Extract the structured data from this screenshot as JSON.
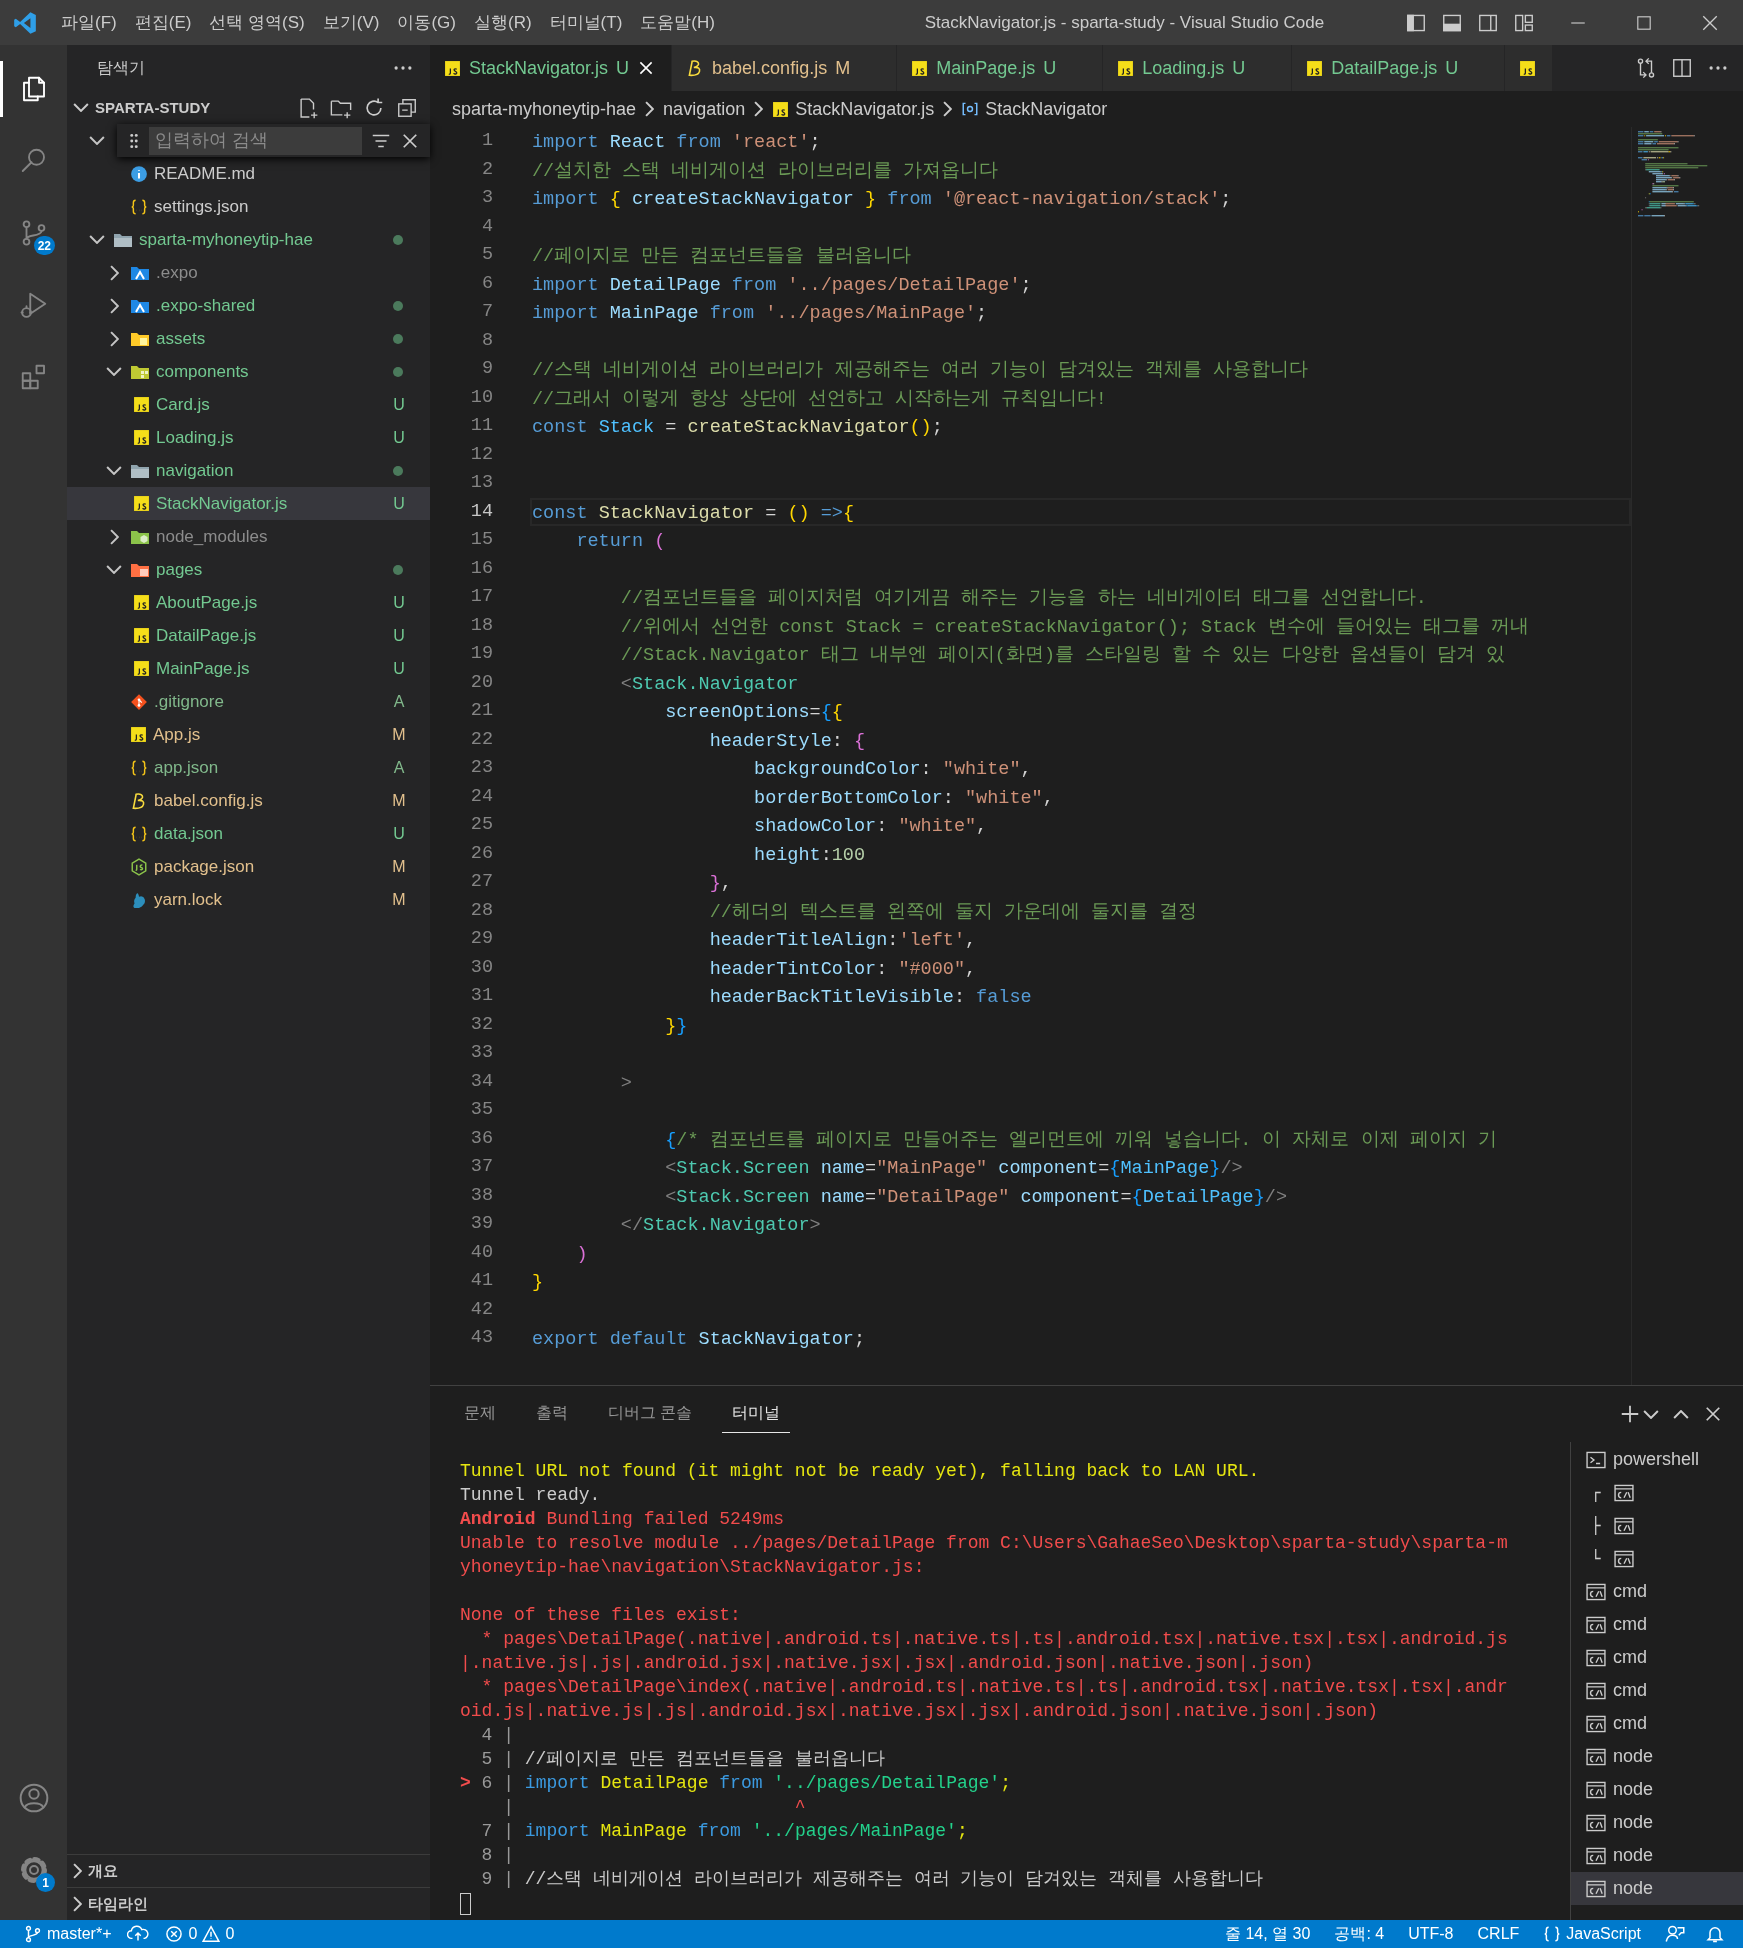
{
  "window": {
    "title": "StackNavigator.js - sparta-study - Visual Studio Code",
    "menu": [
      "파일(F)",
      "편집(E)",
      "선택 영역(S)",
      "보기(V)",
      "이동(G)",
      "실행(R)",
      "터미널(T)",
      "도움말(H)"
    ]
  },
  "activity_bar": {
    "top": [
      {
        "kind": "files",
        "selected": true
      },
      {
        "kind": "search",
        "selected": false
      },
      {
        "kind": "source-control",
        "selected": false,
        "badge": "22"
      },
      {
        "kind": "run-debug",
        "selected": false
      },
      {
        "kind": "extensions",
        "selected": false
      }
    ],
    "bottom": [
      {
        "kind": "account"
      },
      {
        "kind": "gear",
        "badge": "1"
      }
    ]
  },
  "sidebar": {
    "title": "탐색기",
    "workspace": "SPARTA-STUDY",
    "find": {
      "placeholder": "입력하여 검색"
    },
    "tree": [
      {
        "expanded": true,
        "children": [
          {
            "kind": "info",
            "name": "README.md",
            "selected": false,
            "color": "#cccccc",
            "dot": false
          },
          {
            "kind": "json",
            "name": "settings.json",
            "selected": false,
            "color": "#cccccc",
            "dot": false
          }
        ]
      },
      {
        "kind": "folder",
        "name": "sparta-myhoneytip-hae",
        "expanded": true,
        "selected": false,
        "color": "#73c991",
        "dot": true,
        "children": [
          {
            "kind": "expo",
            "name": ".expo",
            "expanded": false,
            "selected": false,
            "color": "#8c8c8c",
            "dot": false
          },
          {
            "kind": "expo",
            "name": ".expo-shared",
            "expanded": false,
            "selected": false,
            "color": "#73c991",
            "dot": true
          },
          {
            "kind": "assets",
            "name": "assets",
            "expanded": false,
            "selected": false,
            "color": "#73c991",
            "dot": true
          },
          {
            "kind": "components",
            "name": "components",
            "expanded": true,
            "selected": false,
            "color": "#73c991",
            "dot": true,
            "children": [
              {
                "kind": "js",
                "name": "Card.js",
                "selected": false,
                "color": "#73c991",
                "badge": "U",
                "dot": false
              },
              {
                "kind": "js",
                "name": "Loading.js",
                "selected": false,
                "color": "#73c991",
                "badge": "U",
                "dot": false
              }
            ]
          },
          {
            "kind": "folder",
            "name": "navigation",
            "expanded": true,
            "selected": false,
            "color": "#73c991",
            "dot": true,
            "children": [
              {
                "kind": "js",
                "name": "StackNavigator.js",
                "selected": true,
                "color": "#73c991",
                "badge": "U",
                "dot": false
              }
            ]
          },
          {
            "kind": "node",
            "name": "node_modules",
            "expanded": false,
            "selected": false,
            "color": "#8c8c8c",
            "dot": false
          },
          {
            "kind": "pages",
            "name": "pages",
            "expanded": true,
            "selected": false,
            "color": "#73c991",
            "dot": true,
            "children": [
              {
                "kind": "js",
                "name": "AboutPage.js",
                "selected": false,
                "color": "#73c991",
                "badge": "U",
                "dot": false
              },
              {
                "kind": "js",
                "name": "DatailPage.js",
                "selected": false,
                "color": "#73c991",
                "badge": "U",
                "dot": false
              },
              {
                "kind": "js",
                "name": "MainPage.js",
                "selected": false,
                "color": "#73c991",
                "badge": "U",
                "dot": false
              }
            ]
          },
          {
            "kind": "git",
            "name": ".gitignore",
            "selected": false,
            "color": "#81b88b",
            "badge": "A",
            "dot": false
          },
          {
            "kind": "js",
            "name": "App.js",
            "selected": false,
            "color": "#e2c08d",
            "badge": "M",
            "dot": false
          },
          {
            "kind": "json",
            "name": "app.json",
            "selected": false,
            "color": "#81b88b",
            "badge": "A",
            "dot": false
          },
          {
            "kind": "babel",
            "name": "babel.config.js",
            "selected": false,
            "color": "#e2c08d",
            "badge": "M",
            "dot": false
          },
          {
            "kind": "json",
            "name": "data.json",
            "selected": false,
            "color": "#73c991",
            "badge": "U",
            "dot": false
          },
          {
            "kind": "nodejs",
            "name": "package.json",
            "selected": false,
            "color": "#e2c08d",
            "badge": "M",
            "dot": false
          },
          {
            "kind": "yarn",
            "name": "yarn.lock",
            "selected": false,
            "color": "#e2c08d",
            "badge": "M",
            "dot": false
          }
        ]
      }
    ],
    "sections": [
      {
        "label": "개요",
        "expanded": false
      },
      {
        "label": "타임라인",
        "expanded": false
      }
    ]
  },
  "editor": {
    "tabs": [
      {
        "label": "StackNavigator.js",
        "kind": "js",
        "color": "#73c991",
        "badge": "U",
        "selected": true
      },
      {
        "label": "babel.config.js",
        "kind": "babel",
        "color": "#e2c08d",
        "badge": "M",
        "selected": false
      },
      {
        "label": "MainPage.js",
        "kind": "js",
        "color": "#73c991",
        "badge": "U",
        "selected": false
      },
      {
        "label": "Loading.js",
        "kind": "js",
        "color": "#73c991",
        "badge": "U",
        "selected": false
      },
      {
        "label": "DatailPage.js",
        "kind": "js",
        "color": "#73c991",
        "badge": "U",
        "selected": false
      },
      {
        "kind": "js",
        "selected": false
      }
    ],
    "breadcrumb": [
      {
        "label": "sparta-myhoneytip-hae",
        "kind": "folder"
      },
      {
        "label": "navigation",
        "kind": "folder"
      },
      {
        "label": "StackNavigator.js",
        "kind": "file"
      },
      {
        "label": "StackNavigator",
        "kind": "symbol"
      }
    ],
    "lines": [
      {
        "number": "1",
        "current": false,
        "tokens": [
          {
            "text": "import ",
            "kind": "keyword"
          },
          {
            "text": "React ",
            "kind": "variable"
          },
          {
            "text": "from ",
            "kind": "keyword"
          },
          {
            "text": "'react'",
            "kind": "string"
          },
          {
            "text": ";",
            "kind": "punct"
          }
        ]
      },
      {
        "number": "2",
        "current": false,
        "tokens": [
          {
            "text": "//설치한 스택 네비게이션 라이브러리를 가져옵니다",
            "kind": "comment"
          }
        ]
      },
      {
        "number": "3",
        "current": false,
        "tokens": [
          {
            "text": "import ",
            "kind": "keyword"
          },
          {
            "text": "{ ",
            "kind": "bracket"
          },
          {
            "text": "createStackNavigator ",
            "kind": "variable"
          },
          {
            "text": "} ",
            "kind": "bracket"
          },
          {
            "text": "from ",
            "kind": "keyword"
          },
          {
            "text": "'@react-navigation/stack'",
            "kind": "string"
          },
          {
            "text": ";",
            "kind": "punct"
          }
        ]
      },
      {
        "number": "4",
        "current": false
      },
      {
        "number": "5",
        "current": false,
        "tokens": [
          {
            "text": "//페이지로 만든 컴포넌트들을 불러옵니다",
            "kind": "comment"
          }
        ]
      },
      {
        "number": "6",
        "current": false,
        "tokens": [
          {
            "text": "import ",
            "kind": "keyword"
          },
          {
            "text": "DetailPage ",
            "kind": "variable"
          },
          {
            "text": "from ",
            "kind": "keyword"
          },
          {
            "text": "'../pages/DetailPage'",
            "kind": "string"
          },
          {
            "text": ";",
            "kind": "punct"
          }
        ]
      },
      {
        "number": "7",
        "current": false,
        "tokens": [
          {
            "text": "import ",
            "kind": "keyword"
          },
          {
            "text": "MainPage ",
            "kind": "variable"
          },
          {
            "text": "from ",
            "kind": "keyword"
          },
          {
            "text": "'../pages/MainPage'",
            "kind": "string"
          },
          {
            "text": ";",
            "kind": "punct"
          }
        ]
      },
      {
        "number": "8",
        "current": false
      },
      {
        "number": "9",
        "current": false,
        "tokens": [
          {
            "text": "//스택 네비게이션 라이브러리가 제공해주는 여러 기능이 담겨있는 객체를 사용합니다",
            "kind": "comment"
          }
        ]
      },
      {
        "number": "10",
        "current": false,
        "tokens": [
          {
            "text": "//그래서 이렇게 항상 상단에 선언하고 시작하는게 규칙입니다!",
            "kind": "comment"
          }
        ]
      },
      {
        "number": "11",
        "current": false,
        "tokens": [
          {
            "text": "const ",
            "kind": "keyword"
          },
          {
            "text": "Stack",
            "kind": "constant"
          },
          {
            "text": " = ",
            "kind": "punct"
          },
          {
            "text": "createStackNavigator",
            "kind": "function"
          },
          {
            "text": "()",
            "kind": "bracket"
          },
          {
            "text": ";",
            "kind": "punct"
          }
        ]
      },
      {
        "number": "12",
        "current": false
      },
      {
        "number": "13",
        "current": false
      },
      {
        "number": "14",
        "current": true,
        "tokens": [
          {
            "text": "const ",
            "kind": "keyword"
          },
          {
            "text": "StackNavigator",
            "kind": "function"
          },
          {
            "text": " = ",
            "kind": "punct"
          },
          {
            "text": "()",
            "kind": "bracket"
          },
          {
            "text": " =>",
            "kind": "keyword"
          },
          {
            "text": "{",
            "kind": "bracket"
          }
        ]
      },
      {
        "number": "15",
        "current": false,
        "tokens": [
          {
            "text": "    return ",
            "kind": "keyword"
          },
          {
            "text": "(",
            "kind": "bracket2"
          }
        ]
      },
      {
        "number": "16",
        "current": false
      },
      {
        "number": "17",
        "current": false,
        "tokens": [
          {
            "text": "        //컴포넌트들을 페이지처럼 여기게끔 해주는 기능을 하는 네비게이터 태그를 선언합니다.",
            "kind": "comment"
          }
        ]
      },
      {
        "number": "18",
        "current": false,
        "tokens": [
          {
            "text": "        //위에서 선언한 const Stack = createStackNavigator(); Stack 변수에 들어있는 태그를 꺼내",
            "kind": "comment"
          }
        ]
      },
      {
        "number": "19",
        "current": false,
        "tokens": [
          {
            "text": "        //Stack.Navigator 태그 내부엔 페이지(화면)를 스타일링 할 수 있는 다양한 옵션들이 담겨 있",
            "kind": "comment"
          }
        ]
      },
      {
        "number": "20",
        "current": false,
        "tokens": [
          {
            "text": "        <",
            "kind": "tagpunct"
          },
          {
            "text": "Stack.Navigator",
            "kind": "tag"
          }
        ]
      },
      {
        "number": "21",
        "current": false,
        "tokens": [
          {
            "text": "            screenOptions",
            "kind": "attr"
          },
          {
            "text": "=",
            "kind": "punct"
          },
          {
            "text": "{",
            "kind": "bracket3"
          },
          {
            "text": "{",
            "kind": "bracket"
          }
        ]
      },
      {
        "number": "22",
        "current": false,
        "tokens": [
          {
            "text": "                headerStyle",
            "kind": "variable"
          },
          {
            "text": ": ",
            "kind": "punct"
          },
          {
            "text": "{",
            "kind": "bracket2"
          }
        ]
      },
      {
        "number": "23",
        "current": false,
        "tokens": [
          {
            "text": "                    backgroundColor",
            "kind": "variable"
          },
          {
            "text": ": ",
            "kind": "punct"
          },
          {
            "text": "\"white\"",
            "kind": "string"
          },
          {
            "text": ",",
            "kind": "punct"
          }
        ]
      },
      {
        "number": "24",
        "current": false,
        "tokens": [
          {
            "text": "                    borderBottomColor",
            "kind": "variable"
          },
          {
            "text": ": ",
            "kind": "punct"
          },
          {
            "text": "\"white\"",
            "kind": "string"
          },
          {
            "text": ",",
            "kind": "punct"
          }
        ]
      },
      {
        "number": "25",
        "current": false,
        "tokens": [
          {
            "text": "                    shadowColor",
            "kind": "variable"
          },
          {
            "text": ": ",
            "kind": "punct"
          },
          {
            "text": "\"white\"",
            "kind": "string"
          },
          {
            "text": ",",
            "kind": "punct"
          }
        ]
      },
      {
        "number": "26",
        "current": false,
        "tokens": [
          {
            "text": "                    height",
            "kind": "variable"
          },
          {
            "text": ":",
            "kind": "punct"
          },
          {
            "text": "100",
            "kind": "number"
          }
        ]
      },
      {
        "number": "27",
        "current": false,
        "tokens": [
          {
            "text": "                }",
            "kind": "bracket2"
          },
          {
            "text": ",",
            "kind": "punct"
          }
        ]
      },
      {
        "number": "28",
        "current": false,
        "tokens": [
          {
            "text": "                //헤더의 텍스트를 왼쪽에 둘지 가운데에 둘지를 결정",
            "kind": "comment"
          }
        ]
      },
      {
        "number": "29",
        "current": false,
        "tokens": [
          {
            "text": "                headerTitleAlign",
            "kind": "variable"
          },
          {
            "text": ":",
            "kind": "punct"
          },
          {
            "text": "'left'",
            "kind": "string"
          },
          {
            "text": ",",
            "kind": "punct"
          }
        ]
      },
      {
        "number": "30",
        "current": false,
        "tokens": [
          {
            "text": "                headerTintColor",
            "kind": "variable"
          },
          {
            "text": ": ",
            "kind": "punct"
          },
          {
            "text": "\"#000\"",
            "kind": "string"
          },
          {
            "text": ",",
            "kind": "punct"
          }
        ]
      },
      {
        "number": "31",
        "current": false,
        "tokens": [
          {
            "text": "                headerBackTitleVisible",
            "kind": "variable"
          },
          {
            "text": ": ",
            "kind": "punct"
          },
          {
            "text": "false",
            "kind": "keyword"
          }
        ]
      },
      {
        "number": "32",
        "current": false,
        "tokens": [
          {
            "text": "            }",
            "kind": "bracket"
          },
          {
            "text": "}",
            "kind": "bracket3"
          }
        ]
      },
      {
        "number": "33",
        "current": false
      },
      {
        "number": "34",
        "current": false,
        "tokens": [
          {
            "text": "        >",
            "kind": "tagpunct"
          }
        ]
      },
      {
        "number": "35",
        "current": false
      },
      {
        "number": "36",
        "current": false,
        "tokens": [
          {
            "text": "            {",
            "kind": "bracket3"
          },
          {
            "text": "/* 컴포넌트를 페이지로 만들어주는 엘리먼트에 끼워 넣습니다. 이 자체로 이제 페이지 기",
            "kind": "comment"
          }
        ]
      },
      {
        "number": "37",
        "current": false,
        "tokens": [
          {
            "text": "            <",
            "kind": "tagpunct"
          },
          {
            "text": "Stack.Screen ",
            "kind": "tag"
          },
          {
            "text": "name",
            "kind": "attr"
          },
          {
            "text": "=",
            "kind": "punct"
          },
          {
            "text": "\"MainPage\" ",
            "kind": "string"
          },
          {
            "text": "component",
            "kind": "attr"
          },
          {
            "text": "=",
            "kind": "punct"
          },
          {
            "text": "{",
            "kind": "bracket3"
          },
          {
            "text": "MainPage",
            "kind": "constant"
          },
          {
            "text": "}",
            "kind": "bracket3"
          },
          {
            "text": "/>",
            "kind": "tagpunct"
          }
        ]
      },
      {
        "number": "38",
        "current": false,
        "tokens": [
          {
            "text": "            <",
            "kind": "tagpunct"
          },
          {
            "text": "Stack.Screen ",
            "kind": "tag"
          },
          {
            "text": "name",
            "kind": "attr"
          },
          {
            "text": "=",
            "kind": "punct"
          },
          {
            "text": "\"DetailPage\" ",
            "kind": "string"
          },
          {
            "text": "component",
            "kind": "attr"
          },
          {
            "text": "=",
            "kind": "punct"
          },
          {
            "text": "{",
            "kind": "bracket3"
          },
          {
            "text": "DetailPage",
            "kind": "constant"
          },
          {
            "text": "}",
            "kind": "bracket3"
          },
          {
            "text": "/>",
            "kind": "tagpunct"
          }
        ]
      },
      {
        "number": "39",
        "current": false,
        "tokens": [
          {
            "text": "        </",
            "kind": "tagpunct"
          },
          {
            "text": "Stack.Navigator",
            "kind": "tag"
          },
          {
            "text": ">",
            "kind": "tagpunct"
          }
        ]
      },
      {
        "number": "40",
        "current": false,
        "tokens": [
          {
            "text": "    )",
            "kind": "bracket2"
          }
        ]
      },
      {
        "number": "41",
        "current": false,
        "tokens": [
          {
            "text": "}",
            "kind": "bracket"
          }
        ]
      },
      {
        "number": "42",
        "current": false
      },
      {
        "number": "43",
        "current": false,
        "tokens": [
          {
            "text": "export ",
            "kind": "keyword"
          },
          {
            "text": "default ",
            "kind": "keyword"
          },
          {
            "text": "StackNavigator",
            "kind": "variable"
          },
          {
            "text": ";",
            "kind": "punct"
          }
        ]
      }
    ]
  },
  "panel": {
    "tabs": [
      {
        "label": "문제",
        "selected": false
      },
      {
        "label": "출력",
        "selected": false
      },
      {
        "label": "디버그 콘솔",
        "selected": false
      },
      {
        "label": "터미널",
        "selected": true
      }
    ],
    "terminal_lines": [
      {
        "tokens": [
          {
            "text": "Tunnel URL not found (it might not be ready yet), falling back to LAN URL.",
            "kind": "warn"
          }
        ]
      },
      {
        "tokens": [
          {
            "text": "Tunnel ready.",
            "kind": "plain"
          }
        ]
      },
      {
        "tokens": [
          {
            "text": "Android",
            "kind": "err-bold"
          },
          {
            "text": " Bundling failed 5249ms",
            "kind": "err"
          }
        ]
      },
      {
        "tokens": [
          {
            "text": "Unable to resolve module ../pages/DetailPage from C:\\Users\\GahaeSeo\\Desktop\\sparta-study\\sparta-m",
            "kind": "err"
          }
        ]
      },
      {
        "tokens": [
          {
            "text": "yhoneytip-hae\\navigation\\StackNavigator.js:",
            "kind": "err"
          }
        ]
      },
      {
        "kind": "blank"
      },
      {
        "tokens": [
          {
            "text": "None of these files exist:",
            "kind": "err"
          }
        ]
      },
      {
        "tokens": [
          {
            "text": "  * pages\\DetailPage(.native|.android.ts|.native.ts|.ts|.android.tsx|.native.tsx|.tsx|.android.js",
            "kind": "err"
          }
        ]
      },
      {
        "tokens": [
          {
            "text": "|.native.js|.js|.android.jsx|.native.jsx|.jsx|.android.json|.native.json|.json)",
            "kind": "err"
          }
        ]
      },
      {
        "tokens": [
          {
            "text": "  * pages\\DetailPage\\index(.native|.android.ts|.native.ts|.ts|.android.tsx|.native.tsx|.tsx|.andr",
            "kind": "err"
          }
        ]
      },
      {
        "tokens": [
          {
            "text": "oid.js|.native.js|.js|.android.jsx|.native.jsx|.jsx|.android.json|.native.json|.json)",
            "kind": "err"
          }
        ]
      },
      {
        "tokens": [
          {
            "text": "  4 |",
            "kind": "gutter"
          }
        ]
      },
      {
        "tokens": [
          {
            "text": "  5 | ",
            "kind": "gutter"
          },
          {
            "text": "//페이지로 만든 컴포넌트들을 불러옵니다",
            "kind": "comment"
          }
        ]
      },
      {
        "tokens": [
          {
            "text": "> ",
            "kind": "pointer"
          },
          {
            "text": "6 | ",
            "kind": "gutter"
          },
          {
            "text": "import ",
            "kind": "keyword"
          },
          {
            "text": "DetailPage ",
            "kind": "ident"
          },
          {
            "text": "from ",
            "kind": "keyword"
          },
          {
            "text": "'../pages/DetailPage'",
            "kind": "string"
          },
          {
            "text": ";",
            "kind": "ident"
          }
        ]
      },
      {
        "tokens": [
          {
            "text": "    | ",
            "kind": "gutter"
          },
          {
            "text": "                         ^",
            "kind": "caret"
          }
        ]
      },
      {
        "tokens": [
          {
            "text": "  7 | ",
            "kind": "gutter"
          },
          {
            "text": "import ",
            "kind": "keyword"
          },
          {
            "text": "MainPage ",
            "kind": "ident"
          },
          {
            "text": "from ",
            "kind": "keyword"
          },
          {
            "text": "'../pages/MainPage'",
            "kind": "string"
          },
          {
            "text": ";",
            "kind": "ident"
          }
        ]
      },
      {
        "tokens": [
          {
            "text": "  8 |",
            "kind": "gutter"
          }
        ]
      },
      {
        "tokens": [
          {
            "text": "  9 | ",
            "kind": "gutter"
          },
          {
            "text": "//스택 네비게이션 라이브러리가 제공해주는 여러 기능이 담겨있는 객체를 사용합니다",
            "kind": "comment"
          }
        ]
      }
    ],
    "terminals": [
      {
        "label": "powershell",
        "kind": "powershell",
        "selected": false
      },
      {
        "prefix": "┌",
        "kind": "cmd",
        "selected": false
      },
      {
        "prefix": "├",
        "kind": "cmd",
        "selected": false
      },
      {
        "prefix": "└",
        "kind": "cmd",
        "selected": false
      },
      {
        "label": "cmd",
        "kind": "cmd",
        "selected": false
      },
      {
        "label": "cmd",
        "kind": "cmd",
        "selected": false
      },
      {
        "label": "cmd",
        "kind": "cmd",
        "selected": false
      },
      {
        "label": "cmd",
        "kind": "cmd",
        "selected": false
      },
      {
        "label": "cmd",
        "kind": "cmd",
        "selected": false
      },
      {
        "label": "node",
        "kind": "cmd",
        "selected": false
      },
      {
        "label": "node",
        "kind": "cmd",
        "selected": false
      },
      {
        "label": "node",
        "kind": "cmd",
        "selected": false
      },
      {
        "label": "node",
        "kind": "cmd",
        "selected": false
      },
      {
        "label": "node",
        "kind": "cmd",
        "selected": true
      }
    ]
  },
  "status_bar": {
    "branch": "master*+",
    "errors": "0",
    "warnings": "0",
    "items": [
      {
        "label": "줄 14, 열 30",
        "kind": "text"
      },
      {
        "label": "공백: 4",
        "kind": "text"
      },
      {
        "label": "UTF-8",
        "kind": "text"
      },
      {
        "label": "CRLF",
        "kind": "text"
      },
      {
        "label": "JavaScript",
        "kind": "language"
      }
    ]
  }
}
